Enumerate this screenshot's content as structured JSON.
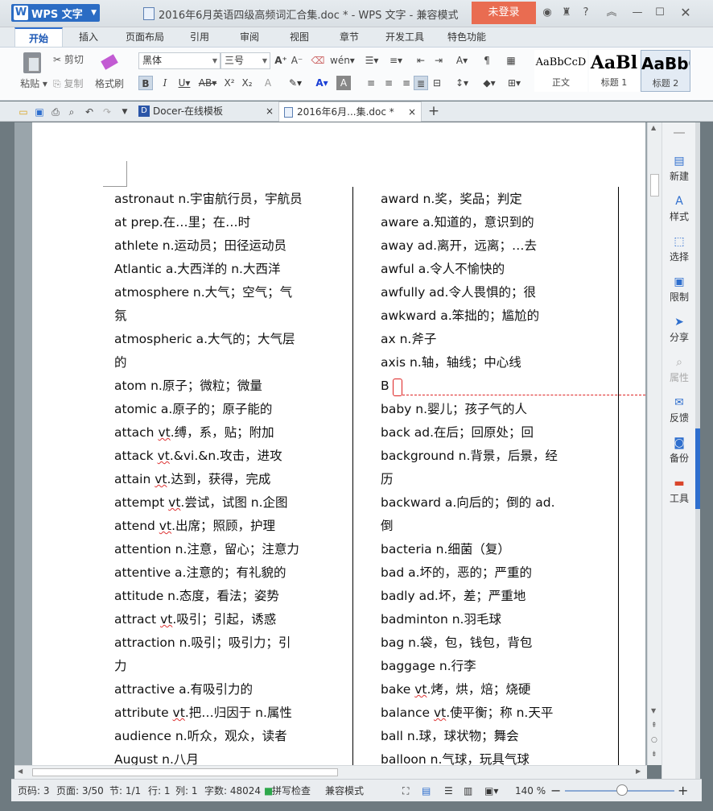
{
  "app": {
    "name": "WPS 文字",
    "doc_title": "2016年6月英语四级高频词汇合集.doc * - WPS 文字 - 兼容模式",
    "login": "未登录"
  },
  "ribbon_tabs": [
    "开始",
    "插入",
    "页面布局",
    "引用",
    "审阅",
    "视图",
    "章节",
    "开发工具",
    "特色功能"
  ],
  "ribbon": {
    "paste": "粘贴",
    "cut": "剪切",
    "copy": "复制",
    "format_painter": "格式刷",
    "font_name": "黑体",
    "font_size": "三号",
    "styles": [
      {
        "preview": "AaBbCcD",
        "name": "正文"
      },
      {
        "preview": "AaBl",
        "name": "标题 1"
      },
      {
        "preview": "AaBbC",
        "name": "标题 2"
      }
    ]
  },
  "doc_tabs": [
    {
      "label": "Docer-在线模板"
    },
    {
      "label": "2016年6月...集.doc *"
    }
  ],
  "left_column": [
    {
      "word": "astronaut",
      "def": " n.宇宙航行员，宇航员"
    },
    {
      "word": "at",
      "def": " prep.在…里；在…时"
    },
    {
      "word": "athlete",
      "def": " n.运动员；田径运动员"
    },
    {
      "word": "Atlantic",
      "def": " a.大西洋的 n.大西洋"
    },
    {
      "word": "atmosphere",
      "def": " n.大气；空气；气"
    },
    {
      "word": "",
      "def": "氛"
    },
    {
      "word": "atmospheric",
      "def": " a.大气的；大气层"
    },
    {
      "word": "",
      "def": "的"
    },
    {
      "word": "atom",
      "def": " n.原子；微粒；微量"
    },
    {
      "word": "atomic",
      "def": " a.原子的；原子能的"
    },
    {
      "word": "attach",
      "def": " vt.缚，系，贴；附加",
      "hl": "vt"
    },
    {
      "word": "attack",
      "def": " vt.&vi.&n.攻击，进攻",
      "hl": "vt"
    },
    {
      "word": "attain",
      "def": " vt.达到，获得，完成",
      "hl": "vt"
    },
    {
      "word": "attempt",
      "def": " vt.尝试，试图 n.企图",
      "hl": "vt"
    },
    {
      "word": "attend",
      "def": " vt.出席；照顾，护理",
      "hl": "vt"
    },
    {
      "word": "attention",
      "def": " n.注意，留心；注意力"
    },
    {
      "word": "attentive",
      "def": " a.注意的；有礼貌的"
    },
    {
      "word": "attitude",
      "def": " n.态度，看法；姿势"
    },
    {
      "word": "attract",
      "def": " vt.吸引；引起，诱惑",
      "hl": "vt"
    },
    {
      "word": "attraction",
      "def": " n.吸引；吸引力；引"
    },
    {
      "word": "",
      "def": "力"
    },
    {
      "word": "attractive",
      "def": " a.有吸引力的"
    },
    {
      "word": "attribute",
      "def": " vt.把…归因于 n.属性",
      "hl": "vt"
    },
    {
      "word": "audience",
      "def": " n.听众，观众，读者"
    },
    {
      "word": "August",
      "def": " n.八月"
    }
  ],
  "right_column": [
    {
      "word": "award",
      "def": " n.奖，奖品；判定"
    },
    {
      "word": "aware",
      "def": " a.知道的，意识到的"
    },
    {
      "word": "away",
      "def": " ad.离开，远离；…去"
    },
    {
      "word": "awful",
      "def": " a.令人不愉快的"
    },
    {
      "word": "awfully",
      "def": " ad.令人畏惧的；很"
    },
    {
      "word": "awkward",
      "def": " a.笨拙的；尴尬的"
    },
    {
      "word": "ax",
      "def": " n.斧子"
    },
    {
      "word": "axis",
      "def": " n.轴，轴线；中心线"
    },
    {
      "word": "B",
      "def": ""
    },
    {
      "word": "baby",
      "def": " n.婴儿；孩子气的人"
    },
    {
      "word": "back",
      "def": " ad.在后；回原处；回"
    },
    {
      "word": "background",
      "def": " n.背景，后景，经"
    },
    {
      "word": "",
      "def": "历"
    },
    {
      "word": "backward",
      "def": " a.向后的；倒的 ad."
    },
    {
      "word": "",
      "def": "倒"
    },
    {
      "word": "bacteria",
      "def": " n.细菌（复）"
    },
    {
      "word": "bad",
      "def": " a.坏的，恶的；严重的"
    },
    {
      "word": "badly",
      "def": " ad.坏，差；严重地"
    },
    {
      "word": "badminton",
      "def": " n.羽毛球"
    },
    {
      "word": "bag",
      "def": " n.袋，包，钱包，背包"
    },
    {
      "word": "baggage",
      "def": " n.行李"
    },
    {
      "word": "bake",
      "def": " vt.烤，烘，焙；烧硬",
      "hl": "vt"
    },
    {
      "word": "balance",
      "def": " vt.使平衡；称 n.天平",
      "hl": "vt"
    },
    {
      "word": "ball",
      "def": " n.球，球状物；舞会"
    },
    {
      "word": "balloon",
      "def": " n.气球，玩具气球"
    }
  ],
  "side_panel": [
    "新建",
    "样式",
    "选择",
    "限制",
    "分享",
    "属性",
    "反馈",
    "备份",
    "工具"
  ],
  "status": {
    "page_code": "页码: 3",
    "pages": "页面: 3/50",
    "section": "节: 1/1",
    "row": "行: 1",
    "col": "列: 1",
    "words": "字数: 48024",
    "spell": "拼写检查",
    "compat": "兼容模式",
    "zoom": "140 %"
  }
}
